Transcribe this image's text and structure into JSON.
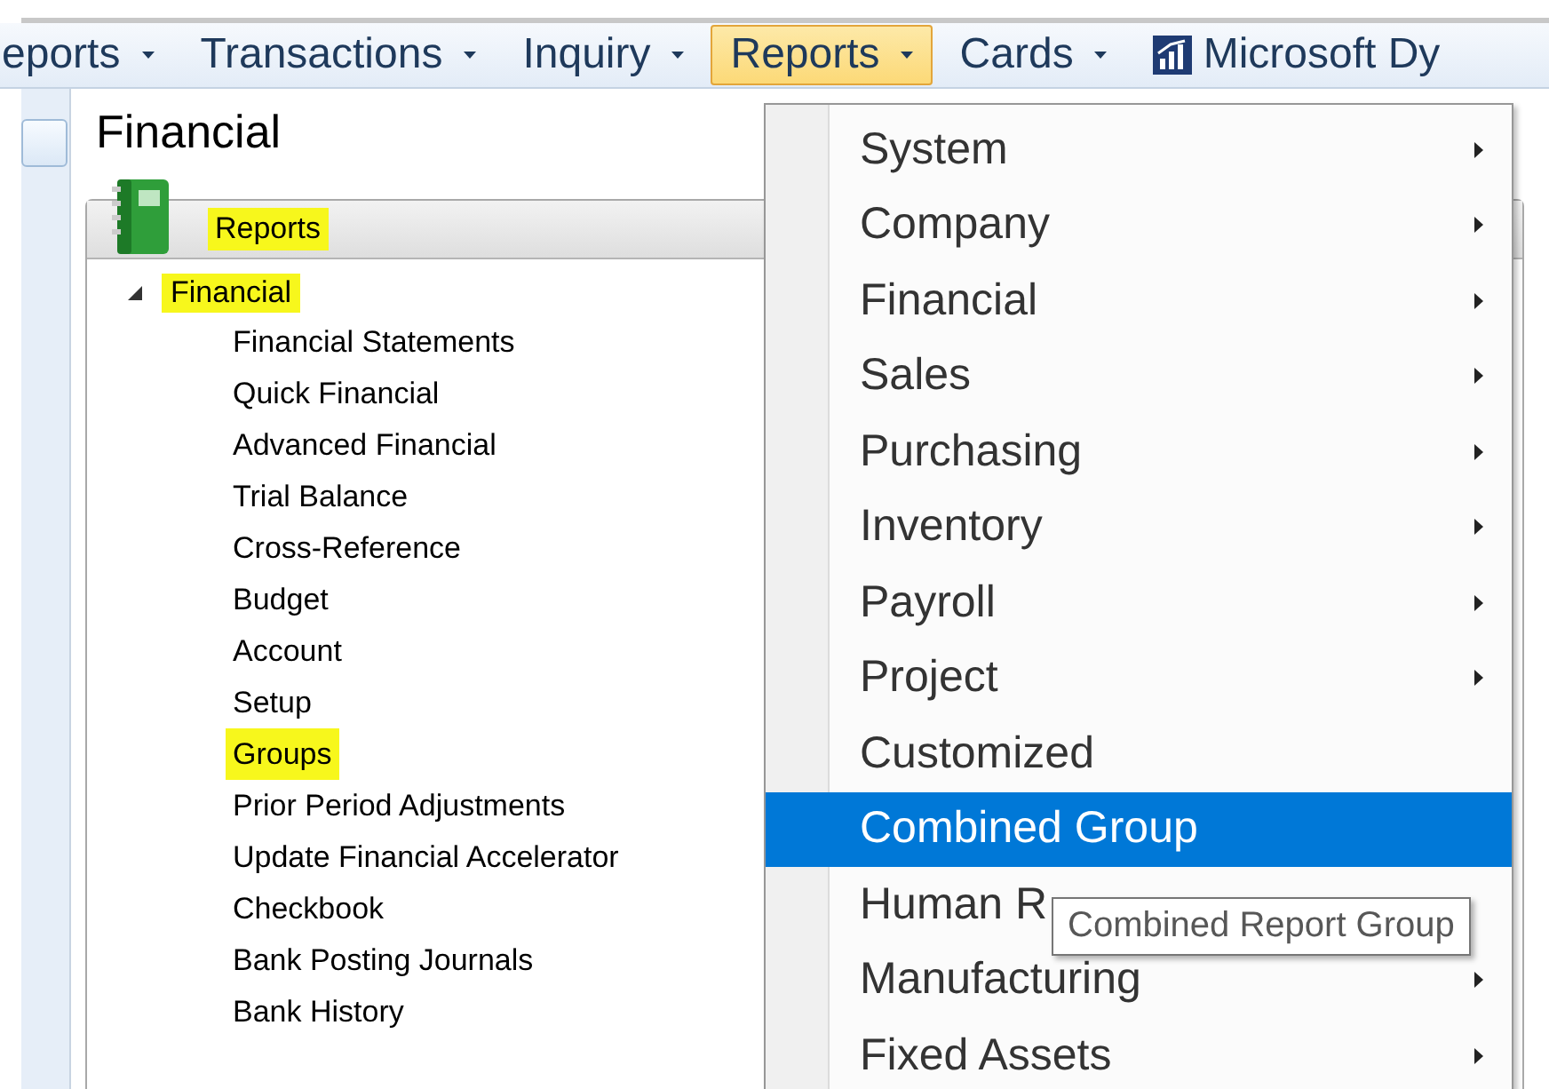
{
  "menubar": [
    {
      "label": "eports",
      "kind": "menu",
      "selected": false
    },
    {
      "label": "Transactions",
      "kind": "menu",
      "selected": false
    },
    {
      "label": "Inquiry",
      "kind": "menu",
      "selected": false
    },
    {
      "label": "Reports",
      "kind": "menu",
      "selected": true
    },
    {
      "label": "Cards",
      "kind": "menu",
      "selected": false
    },
    {
      "label": "Microsoft Dy",
      "kind": "app",
      "selected": false
    }
  ],
  "page": {
    "title": "Financial",
    "panel": {
      "title": "Reports",
      "highlighted": true
    },
    "tree": [
      {
        "label": "Financial",
        "expanded": true,
        "highlighted": true,
        "children": [
          {
            "label": "Financial Statements",
            "highlighted": false
          },
          {
            "label": "Quick Financial",
            "highlighted": false
          },
          {
            "label": "Advanced Financial",
            "highlighted": false
          },
          {
            "label": "Trial Balance",
            "highlighted": false
          },
          {
            "label": "Cross-Reference",
            "highlighted": false
          },
          {
            "label": "Budget",
            "highlighted": false
          },
          {
            "label": "Account",
            "highlighted": false
          },
          {
            "label": "Setup",
            "highlighted": false
          },
          {
            "label": "Groups",
            "highlighted": true
          },
          {
            "label": "Prior Period Adjustments",
            "highlighted": false
          },
          {
            "label": "Update Financial Accelerator",
            "highlighted": false
          },
          {
            "label": "Checkbook",
            "highlighted": false
          },
          {
            "label": "Bank Posting Journals",
            "highlighted": false
          },
          {
            "label": "Bank History",
            "highlighted": false
          }
        ]
      }
    ]
  },
  "dropdown": {
    "items": [
      {
        "label": "System",
        "submenu": true,
        "selected": false
      },
      {
        "label": "Company",
        "submenu": true,
        "selected": false
      },
      {
        "label": "Financial",
        "submenu": true,
        "selected": false
      },
      {
        "label": "Sales",
        "submenu": true,
        "selected": false
      },
      {
        "label": "Purchasing",
        "submenu": true,
        "selected": false
      },
      {
        "label": "Inventory",
        "submenu": true,
        "selected": false
      },
      {
        "label": "Payroll",
        "submenu": true,
        "selected": false
      },
      {
        "label": "Project",
        "submenu": true,
        "selected": false
      },
      {
        "label": "Customized",
        "submenu": false,
        "selected": false
      },
      {
        "label": "Combined Group",
        "submenu": false,
        "selected": true
      },
      {
        "label": "Human R",
        "submenu": false,
        "selected": false
      },
      {
        "label": "Manufacturing",
        "submenu": true,
        "selected": false
      },
      {
        "label": "Fixed Assets",
        "submenu": true,
        "selected": false
      }
    ],
    "tooltip": "Combined Report Group"
  }
}
